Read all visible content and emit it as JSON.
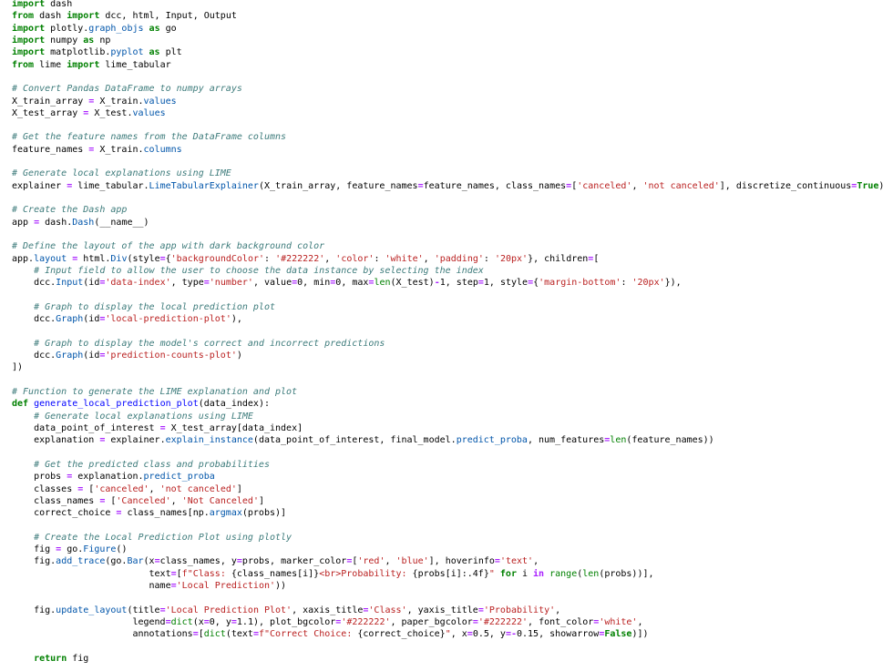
{
  "code_lines": [
    [
      [
        "import",
        "kw"
      ],
      [
        " dash",
        ""
      ]
    ],
    [
      [
        "from",
        "kw"
      ],
      [
        " dash ",
        ""
      ],
      [
        "import",
        "kw"
      ],
      [
        " dcc, html, Input, Output",
        ""
      ]
    ],
    [
      [
        "import",
        "kw"
      ],
      [
        " plotly.",
        ""
      ],
      [
        "graph_objs",
        "at"
      ],
      [
        " ",
        ""
      ],
      [
        "as",
        "kw"
      ],
      [
        " go",
        ""
      ]
    ],
    [
      [
        "import",
        "kw"
      ],
      [
        " numpy ",
        ""
      ],
      [
        "as",
        "kw"
      ],
      [
        " np",
        ""
      ]
    ],
    [
      [
        "import",
        "kw"
      ],
      [
        " matplotlib.",
        ""
      ],
      [
        "pyplot",
        "at"
      ],
      [
        " ",
        ""
      ],
      [
        "as",
        "kw"
      ],
      [
        " plt",
        ""
      ]
    ],
    [
      [
        "from",
        "kw"
      ],
      [
        " lime ",
        ""
      ],
      [
        "import",
        "kw"
      ],
      [
        " lime_tabular",
        ""
      ]
    ],
    [],
    [
      [
        "# Convert Pandas DataFrame to numpy arrays",
        "cm"
      ]
    ],
    [
      [
        "X_train_array ",
        ""
      ],
      [
        "=",
        "op"
      ],
      [
        " X_train.",
        ""
      ],
      [
        "values",
        "at"
      ]
    ],
    [
      [
        "X_test_array ",
        ""
      ],
      [
        "=",
        "op"
      ],
      [
        " X_test.",
        ""
      ],
      [
        "values",
        "at"
      ]
    ],
    [],
    [
      [
        "# Get the feature names from the DataFrame columns",
        "cm"
      ]
    ],
    [
      [
        "feature_names ",
        ""
      ],
      [
        "=",
        "op"
      ],
      [
        " X_train.",
        ""
      ],
      [
        "columns",
        "at"
      ]
    ],
    [],
    [
      [
        "# Generate local explanations using LIME",
        "cm"
      ]
    ],
    [
      [
        "explainer ",
        ""
      ],
      [
        "=",
        "op"
      ],
      [
        " lime_tabular.",
        ""
      ],
      [
        "LimeTabularExplainer",
        "at"
      ],
      [
        "(X_train_array, feature_names",
        ""
      ],
      [
        "=",
        "op"
      ],
      [
        "feature_names, class_names",
        ""
      ],
      [
        "=",
        "op"
      ],
      [
        "[",
        ""
      ],
      [
        "'canceled'",
        "st"
      ],
      [
        ", ",
        ""
      ],
      [
        "'not canceled'",
        "st"
      ],
      [
        "], discretize_continuous",
        ""
      ],
      [
        "=",
        "op"
      ],
      [
        "True",
        "kw"
      ],
      [
        ")",
        ""
      ]
    ],
    [],
    [
      [
        "# Create the Dash app",
        "cm"
      ]
    ],
    [
      [
        "app ",
        ""
      ],
      [
        "=",
        "op"
      ],
      [
        " dash.",
        ""
      ],
      [
        "Dash",
        "at"
      ],
      [
        "(__name__)",
        ""
      ]
    ],
    [],
    [
      [
        "# Define the layout of the app with dark background color",
        "cm"
      ]
    ],
    [
      [
        "app.",
        ""
      ],
      [
        "layout",
        "at"
      ],
      [
        " ",
        ""
      ],
      [
        "=",
        "op"
      ],
      [
        " html.",
        ""
      ],
      [
        "Div",
        "at"
      ],
      [
        "(style",
        ""
      ],
      [
        "=",
        "op"
      ],
      [
        "{",
        ""
      ],
      [
        "'backgroundColor'",
        "st"
      ],
      [
        ": ",
        ""
      ],
      [
        "'#222222'",
        "st"
      ],
      [
        ", ",
        ""
      ],
      [
        "'color'",
        "st"
      ],
      [
        ": ",
        ""
      ],
      [
        "'white'",
        "st"
      ],
      [
        ", ",
        ""
      ],
      [
        "'padding'",
        "st"
      ],
      [
        ": ",
        ""
      ],
      [
        "'20px'",
        "st"
      ],
      [
        "}, children",
        ""
      ],
      [
        "=",
        "op"
      ],
      [
        "[",
        ""
      ]
    ],
    [
      [
        "    ",
        ""
      ],
      [
        "# Input field to allow the user to choose the data instance by selecting the index",
        "cm"
      ]
    ],
    [
      [
        "    dcc.",
        ""
      ],
      [
        "Input",
        "at"
      ],
      [
        "(id",
        ""
      ],
      [
        "=",
        "op"
      ],
      [
        "'data-index'",
        "st"
      ],
      [
        ", type",
        ""
      ],
      [
        "=",
        "op"
      ],
      [
        "'number'",
        "st"
      ],
      [
        ", value",
        ""
      ],
      [
        "=",
        "op"
      ],
      [
        "0, min",
        ""
      ],
      [
        "=",
        "op"
      ],
      [
        "0, max",
        ""
      ],
      [
        "=",
        "op"
      ],
      [
        "len",
        "nb"
      ],
      [
        "(X_test)",
        ""
      ],
      [
        "-",
        "op"
      ],
      [
        "1, step",
        ""
      ],
      [
        "=",
        "op"
      ],
      [
        "1, style",
        ""
      ],
      [
        "=",
        "op"
      ],
      [
        "{",
        ""
      ],
      [
        "'margin-bottom'",
        "st"
      ],
      [
        ": ",
        ""
      ],
      [
        "'20px'",
        "st"
      ],
      [
        "}),",
        ""
      ]
    ],
    [],
    [
      [
        "    ",
        ""
      ],
      [
        "# Graph to display the local prediction plot",
        "cm"
      ]
    ],
    [
      [
        "    dcc.",
        ""
      ],
      [
        "Graph",
        "at"
      ],
      [
        "(id",
        ""
      ],
      [
        "=",
        "op"
      ],
      [
        "'local-prediction-plot'",
        "st"
      ],
      [
        "),",
        ""
      ]
    ],
    [],
    [
      [
        "    ",
        ""
      ],
      [
        "# Graph to display the model's correct and incorrect predictions",
        "cm"
      ]
    ],
    [
      [
        "    dcc.",
        ""
      ],
      [
        "Graph",
        "at"
      ],
      [
        "(id",
        ""
      ],
      [
        "=",
        "op"
      ],
      [
        "'prediction-counts-plot'",
        "st"
      ],
      [
        ")",
        ""
      ]
    ],
    [
      [
        "])",
        ""
      ]
    ],
    [],
    [
      [
        "# Function to generate the LIME explanation and plot",
        "cm"
      ]
    ],
    [
      [
        "def",
        "kw"
      ],
      [
        " ",
        ""
      ],
      [
        "generate_local_prediction_plot",
        "fn"
      ],
      [
        "(data_index):",
        ""
      ]
    ],
    [
      [
        "    ",
        ""
      ],
      [
        "# Generate local explanations using LIME",
        "cm"
      ]
    ],
    [
      [
        "    data_point_of_interest ",
        ""
      ],
      [
        "=",
        "op"
      ],
      [
        " X_test_array[data_index]",
        ""
      ]
    ],
    [
      [
        "    explanation ",
        ""
      ],
      [
        "=",
        "op"
      ],
      [
        " explainer.",
        ""
      ],
      [
        "explain_instance",
        "at"
      ],
      [
        "(data_point_of_interest, final_model.",
        ""
      ],
      [
        "predict_proba",
        "at"
      ],
      [
        ", num_features",
        ""
      ],
      [
        "=",
        "op"
      ],
      [
        "len",
        "nb"
      ],
      [
        "(feature_names))",
        ""
      ]
    ],
    [],
    [
      [
        "    ",
        ""
      ],
      [
        "# Get the predicted class and probabilities",
        "cm"
      ]
    ],
    [
      [
        "    probs ",
        ""
      ],
      [
        "=",
        "op"
      ],
      [
        " explanation.",
        ""
      ],
      [
        "predict_proba",
        "at"
      ]
    ],
    [
      [
        "    classes ",
        ""
      ],
      [
        "=",
        "op"
      ],
      [
        " [",
        ""
      ],
      [
        "'canceled'",
        "st"
      ],
      [
        ", ",
        ""
      ],
      [
        "'not canceled'",
        "st"
      ],
      [
        "]",
        ""
      ]
    ],
    [
      [
        "    class_names ",
        ""
      ],
      [
        "=",
        "op"
      ],
      [
        " [",
        ""
      ],
      [
        "'Canceled'",
        "st"
      ],
      [
        ", ",
        ""
      ],
      [
        "'Not Canceled'",
        "st"
      ],
      [
        "]",
        ""
      ]
    ],
    [
      [
        "    correct_choice ",
        ""
      ],
      [
        "=",
        "op"
      ],
      [
        " class_names[np.",
        ""
      ],
      [
        "argmax",
        "at"
      ],
      [
        "(probs)]",
        ""
      ]
    ],
    [],
    [
      [
        "    ",
        ""
      ],
      [
        "# Create the Local Prediction Plot using plotly",
        "cm"
      ]
    ],
    [
      [
        "    fig ",
        ""
      ],
      [
        "=",
        "op"
      ],
      [
        " go.",
        ""
      ],
      [
        "Figure",
        "at"
      ],
      [
        "()",
        ""
      ]
    ],
    [
      [
        "    fig.",
        ""
      ],
      [
        "add_trace",
        "at"
      ],
      [
        "(go.",
        ""
      ],
      [
        "Bar",
        "at"
      ],
      [
        "(x",
        ""
      ],
      [
        "=",
        "op"
      ],
      [
        "class_names, y",
        ""
      ],
      [
        "=",
        "op"
      ],
      [
        "probs, marker_color",
        ""
      ],
      [
        "=",
        "op"
      ],
      [
        "[",
        ""
      ],
      [
        "'red'",
        "st"
      ],
      [
        ", ",
        ""
      ],
      [
        "'blue'",
        "st"
      ],
      [
        "], hoverinfo",
        ""
      ],
      [
        "=",
        "op"
      ],
      [
        "'text'",
        "st"
      ],
      [
        ",",
        ""
      ]
    ],
    [
      [
        "                         text",
        ""
      ],
      [
        "=",
        "op"
      ],
      [
        "[",
        ""
      ],
      [
        "f\"Class: ",
        "st"
      ],
      [
        "{class_names[i]}",
        ""
      ],
      [
        "<br>Probability: ",
        "st"
      ],
      [
        "{probs[i]:.4f}",
        ""
      ],
      [
        "\"",
        "st"
      ],
      [
        " ",
        ""
      ],
      [
        "for",
        "kw"
      ],
      [
        " i ",
        ""
      ],
      [
        "in",
        "op"
      ],
      [
        " ",
        ""
      ],
      [
        "range",
        "nb"
      ],
      [
        "(",
        ""
      ],
      [
        "len",
        "nb"
      ],
      [
        "(probs))],",
        ""
      ]
    ],
    [
      [
        "                         name",
        ""
      ],
      [
        "=",
        "op"
      ],
      [
        "'Local Prediction'",
        "st"
      ],
      [
        "))",
        ""
      ]
    ],
    [],
    [
      [
        "    fig.",
        ""
      ],
      [
        "update_layout",
        "at"
      ],
      [
        "(title",
        ""
      ],
      [
        "=",
        "op"
      ],
      [
        "'Local Prediction Plot'",
        "st"
      ],
      [
        ", xaxis_title",
        ""
      ],
      [
        "=",
        "op"
      ],
      [
        "'Class'",
        "st"
      ],
      [
        ", yaxis_title",
        ""
      ],
      [
        "=",
        "op"
      ],
      [
        "'Probability'",
        "st"
      ],
      [
        ",",
        ""
      ]
    ],
    [
      [
        "                      legend",
        ""
      ],
      [
        "=",
        "op"
      ],
      [
        "dict",
        "nb"
      ],
      [
        "(x",
        ""
      ],
      [
        "=",
        "op"
      ],
      [
        "0, y",
        ""
      ],
      [
        "=",
        "op"
      ],
      [
        "1.1), plot_bgcolor",
        ""
      ],
      [
        "=",
        "op"
      ],
      [
        "'#222222'",
        "st"
      ],
      [
        ", paper_bgcolor",
        ""
      ],
      [
        "=",
        "op"
      ],
      [
        "'#222222'",
        "st"
      ],
      [
        ", font_color",
        ""
      ],
      [
        "=",
        "op"
      ],
      [
        "'white'",
        "st"
      ],
      [
        ",",
        ""
      ]
    ],
    [
      [
        "                      annotations",
        ""
      ],
      [
        "=",
        "op"
      ],
      [
        "[",
        ""
      ],
      [
        "dict",
        "nb"
      ],
      [
        "(text",
        ""
      ],
      [
        "=",
        "op"
      ],
      [
        "f\"Correct Choice: ",
        "st"
      ],
      [
        "{correct_choice}",
        ""
      ],
      [
        "\"",
        "st"
      ],
      [
        ", x",
        ""
      ],
      [
        "=",
        "op"
      ],
      [
        "0.5, y",
        ""
      ],
      [
        "=",
        "op"
      ],
      [
        "-",
        "op"
      ],
      [
        "0.15, showarrow",
        ""
      ],
      [
        "=",
        "op"
      ],
      [
        "False",
        "kw"
      ],
      [
        ")])",
        ""
      ]
    ],
    [],
    [
      [
        "    ",
        ""
      ],
      [
        "return",
        "kw"
      ],
      [
        " fig",
        ""
      ]
    ]
  ]
}
